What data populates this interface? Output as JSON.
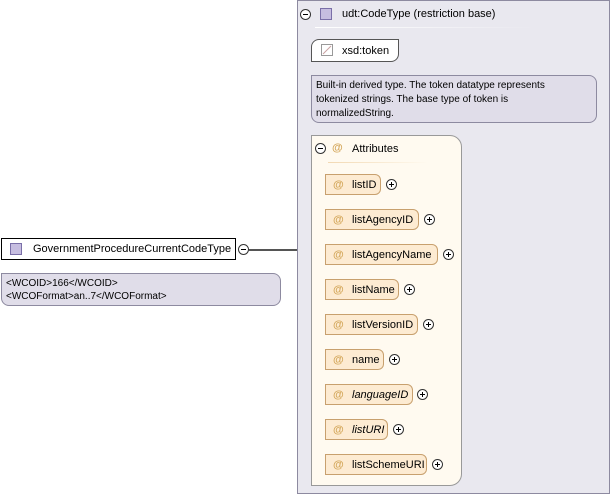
{
  "root_element": {
    "name": "GovernmentProcedureCurrentCodeType",
    "annotation_lines": [
      "<WCOID>166</WCOID>",
      "<WCOFormat>an..7</WCOFormat>"
    ]
  },
  "complex_type": {
    "title": "udt:CodeType (restriction base)",
    "base_type": "xsd:token",
    "base_annotation_lines": [
      "Built-in derived type. The token datatype represents",
      "tokenized strings. The base type of token is",
      "normalizedString."
    ],
    "attributes_group": {
      "title": "Attributes",
      "symbol": "@",
      "items": [
        {
          "name": "listID",
          "italic": false
        },
        {
          "name": "listAgencyID",
          "italic": false
        },
        {
          "name": "listAgencyName",
          "italic": false
        },
        {
          "name": "listName",
          "italic": false
        },
        {
          "name": "listVersionID",
          "italic": false
        },
        {
          "name": "name",
          "italic": false
        },
        {
          "name": "languageID",
          "italic": true
        },
        {
          "name": "listURI",
          "italic": true
        },
        {
          "name": "listSchemeURI",
          "italic": false
        }
      ]
    }
  },
  "colors": {
    "type_icon": "#c6bde0",
    "annotation_bg": "#e0dde9",
    "attribute_bg": "#fdebd2",
    "attribute_symbol": "#d4a75a"
  }
}
